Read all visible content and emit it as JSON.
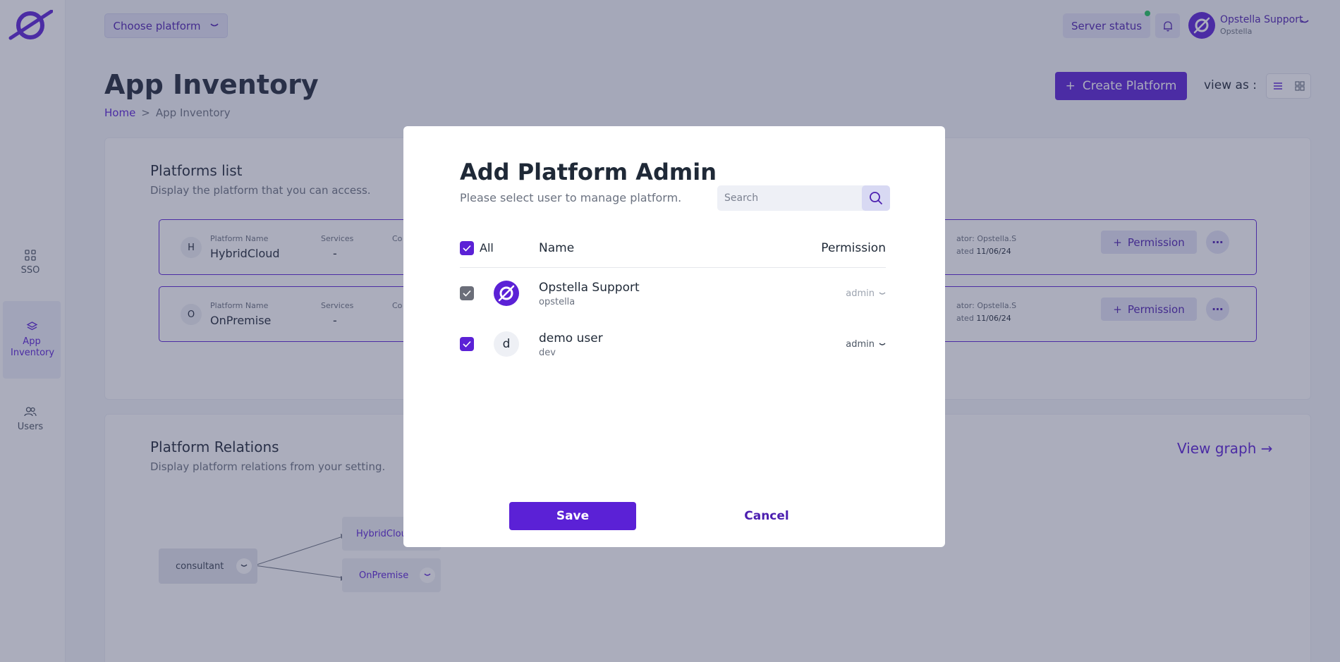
{
  "topbar": {
    "choose_platform": "Choose platform",
    "server_status": "Server status",
    "user_name": "Opstella Support",
    "user_org": "Opstella"
  },
  "sidebar": {
    "items": [
      {
        "label": "SSO",
        "icon": "grid-icon"
      },
      {
        "label": "App Inventory",
        "icon": "layers-icon",
        "active": true
      },
      {
        "label": "Users",
        "icon": "users-icon"
      }
    ]
  },
  "header": {
    "title": "App Inventory",
    "breadcrumb_home": "Home",
    "breadcrumb_sep": ">",
    "breadcrumb_current": "App Inventory",
    "create_label": "Create Platform",
    "view_as": "view as :"
  },
  "platforms_card": {
    "title": "Platforms list",
    "subtitle": "Display the platform that you can access.",
    "name_label": "Platform Name",
    "services_label": "Services",
    "col3_label": "Co",
    "permission_label": "Permission",
    "rows": [
      {
        "initial": "H",
        "name": "HybridCloud",
        "services": "-",
        "creator": "ator: Opstella.S",
        "created_prefix": "ated",
        "created": "11/06/24"
      },
      {
        "initial": "O",
        "name": "OnPremise",
        "services": "-",
        "creator": "ator: Opstella.S",
        "created_prefix": "ated",
        "created": "11/06/24"
      }
    ]
  },
  "relations_card": {
    "title": "Platform Relations",
    "subtitle": "Display platform relations from your setting.",
    "view_graph": "View graph",
    "nodes": {
      "source": "consultant",
      "target1": "HybridClou",
      "target2": "OnPremise"
    }
  },
  "modal": {
    "title": "Add Platform Admin",
    "subtitle": "Please select user to manage platform.",
    "search_placeholder": "Search",
    "all_label": "All",
    "col_name": "Name",
    "col_permission": "Permission",
    "users": [
      {
        "name": "Opstella Support",
        "org": "opstella",
        "permission": "admin",
        "checked": true,
        "locked": true,
        "avatar": "opstella-logo-icon"
      },
      {
        "name": "demo user",
        "org": "dev",
        "permission": "admin",
        "checked": true,
        "locked": false,
        "initial": "d"
      }
    ],
    "save_label": "Save",
    "cancel_label": "Cancel"
  },
  "colors": {
    "brand": "#5b21d6",
    "brand_light": "#e3e4f6",
    "status_online": "#22c55e"
  }
}
